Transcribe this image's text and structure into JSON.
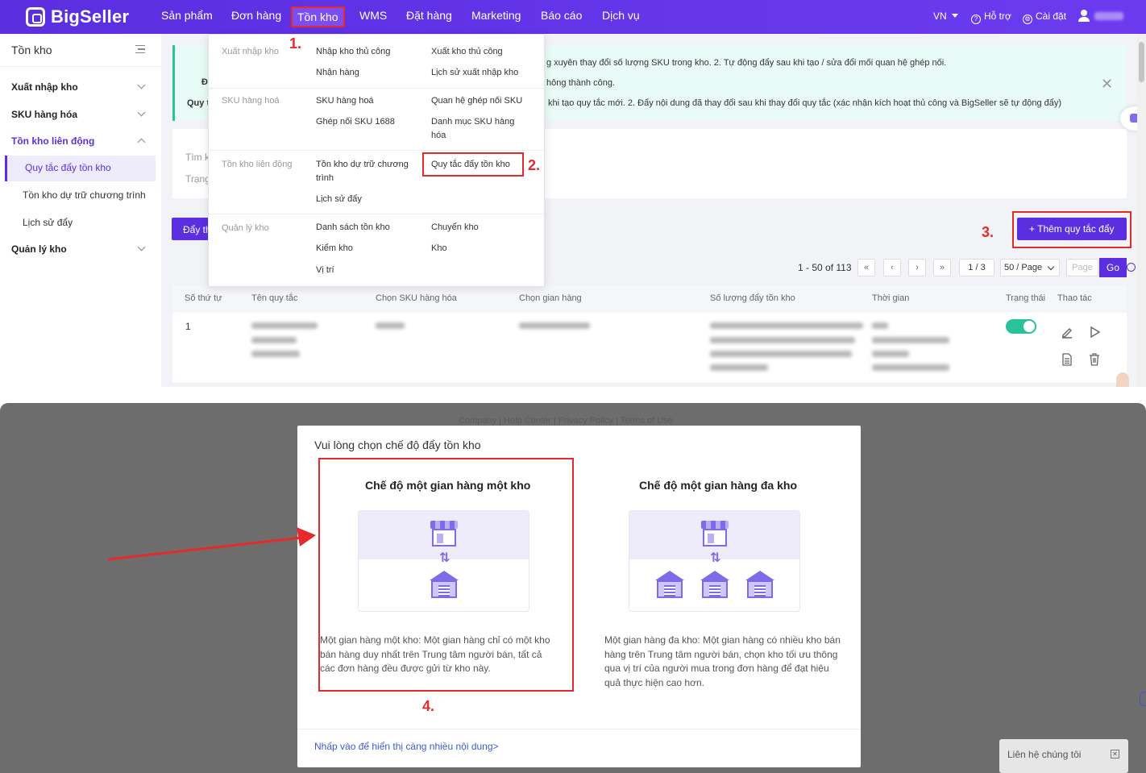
{
  "app": {
    "logo": "BigSeller",
    "nav": [
      "Sản phẩm",
      "Đơn hàng",
      "Tồn kho",
      "WMS",
      "Đặt hàng",
      "Marketing",
      "Báo cáo",
      "Dịch vụ"
    ],
    "lang": "VN",
    "help": "Hỗ trợ",
    "settings": "Cài đặt"
  },
  "sidebar": {
    "title": "Tồn kho",
    "groups": [
      "Xuất nhập kho",
      "SKU hàng hóa",
      "Tồn kho liên động",
      "Quản lý kho"
    ],
    "subs": [
      "Quy tắc đẩy tồn kho",
      "Tồn kho dự trữ chương trình",
      "Lịch sử đẩy"
    ]
  },
  "notice": {
    "line1": "g xuyên thay đổi số lượng SKU trong kho. 2. Tự động đẩy sau khi tạo / sửa đổi mối quan hệ ghép nối.",
    "line2": "hông thành công.",
    "line3": "khi tạo quy tắc mới. 2. Đẩy nội dung đã thay đổi sau khi thay đổi quy tắc (xác nhận kích hoạt thủ công và BigSeller sẽ tự động đẩy)",
    "frag1": "Đ",
    "frag2": "Quy t"
  },
  "filter": {
    "frag1": "Tìm k",
    "frag2": "Trạng"
  },
  "toolbar": {
    "push_frag": "Đẩy th",
    "add_rule": "+ Thêm quy tắc đẩy"
  },
  "pagination": {
    "summary": "1 - 50 of 113",
    "first": "«",
    "prev": "‹",
    "next": "›",
    "last": "»",
    "page": "1 / 3",
    "size": "50 / Page",
    "page_placeholder": "Page",
    "go": "Go"
  },
  "table": {
    "headers": [
      "Số thứ tự",
      "Tên quy tắc",
      "Chọn SKU hàng hóa",
      "Chọn gian hàng",
      "Số lượng đẩy tồn kho",
      "Thời gian",
      "Trạng thái",
      "Thao tác"
    ],
    "row_index": "1"
  },
  "dropdown": {
    "categories": [
      "Xuất nhập kho",
      "SKU hàng hoá",
      "Tồn kho liên động",
      "Quản lý kho"
    ],
    "items": {
      "a1": "Nhập kho thủ công",
      "a2": "Xuất kho thủ công",
      "a3": "Nhận hàng",
      "a4": "Lịch sử xuất nhập kho",
      "b1": "SKU hàng hoá",
      "b2": "Quan hệ ghép nối SKU",
      "b3": "Ghép nối SKU 1688",
      "b4": "Danh mục SKU hàng hóa",
      "c1": "Tồn kho dự trữ chương trình",
      "c2": "Quy tắc đẩy tồn kho",
      "c3": "Lịch sử đẩy",
      "d1": "Danh sách tồn kho",
      "d2": "Chuyển kho",
      "d3": "Kiểm kho",
      "d4": "Kho",
      "d5": "Vị trí"
    }
  },
  "steps": [
    "1.",
    "2.",
    "3.",
    "4."
  ],
  "footer": "Company  |  Help Center  |  Privacy Policy  |  Terms of Use",
  "modal": {
    "title": "Vui lòng chọn chế độ đẩy tồn kho",
    "single_title": "Chế độ một gian hàng một kho",
    "single_desc": "Một gian hàng một kho: Một gian hàng chỉ có một kho bán hàng duy nhất trên Trung tâm người bán, tất cả các đơn hàng đều được gửi từ kho này.",
    "multi_title": "Chế độ một gian hàng đa kho",
    "multi_desc": "Một gian hàng đa kho: Một gian hàng có nhiều kho bán hàng trên Trung tâm người bán, chọn kho tối ưu thông qua vị trí của người mua trong đơn hàng để đạt hiệu quả thực hiện cao hơn.",
    "more_link": "Nhấp vào để hiển thị càng nhiều nội dung>"
  },
  "contact": {
    "label": "Liên hệ chúng tôi"
  },
  "colors": {
    "brand": "#5b2ee0",
    "highlight": "#e32b2b",
    "success": "#2ac29a"
  },
  "icons": [
    "logo-icon",
    "help-icon",
    "gear-icon",
    "user-icon",
    "chevron-down-icon",
    "chevron-up-icon",
    "close-icon",
    "search-icon",
    "edit-icon",
    "play-icon",
    "document-icon",
    "trash-icon",
    "store-icon",
    "warehouse-icon",
    "swap-icon",
    "arrow-icon",
    "chat-icon"
  ]
}
